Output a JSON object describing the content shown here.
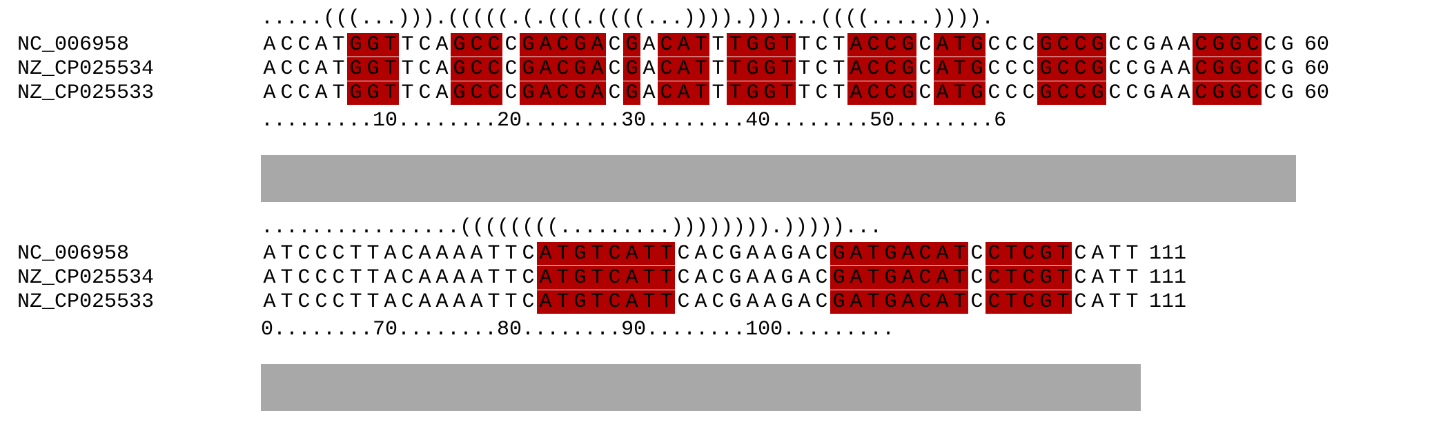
{
  "colors": {
    "paired_column": "#b00000",
    "conservation_bar": "#a8a8a8",
    "text": "#000000"
  },
  "names": [
    "NC_006958",
    "NZ_CP025534",
    "NZ_CP025533"
  ],
  "blocks": [
    {
      "structure": ".....(((...))).(((((.(.(((.((((...)))).)))...((((.....)))).",
      "sequence": "ACCATGGTTCAGCCCGACGACGACATTTGGTTCTACCGCATGCCCGCCGCCGAACGGCCG",
      "end_number": "60",
      "ruler": ".........10........20........30........40........50........6",
      "conservation_fraction": 1.0
    },
    {
      "structure": "................((((((((.........)))))))).))))) ...",
      "sequence": "ATCCCTTACAAAATTCATGTCATTCACGAAGACGATGACATCCTCGTCATT",
      "end_number": "111",
      "ruler": "0........70........80........90........100.........",
      "conservation_fraction": 1.0
    }
  ]
}
